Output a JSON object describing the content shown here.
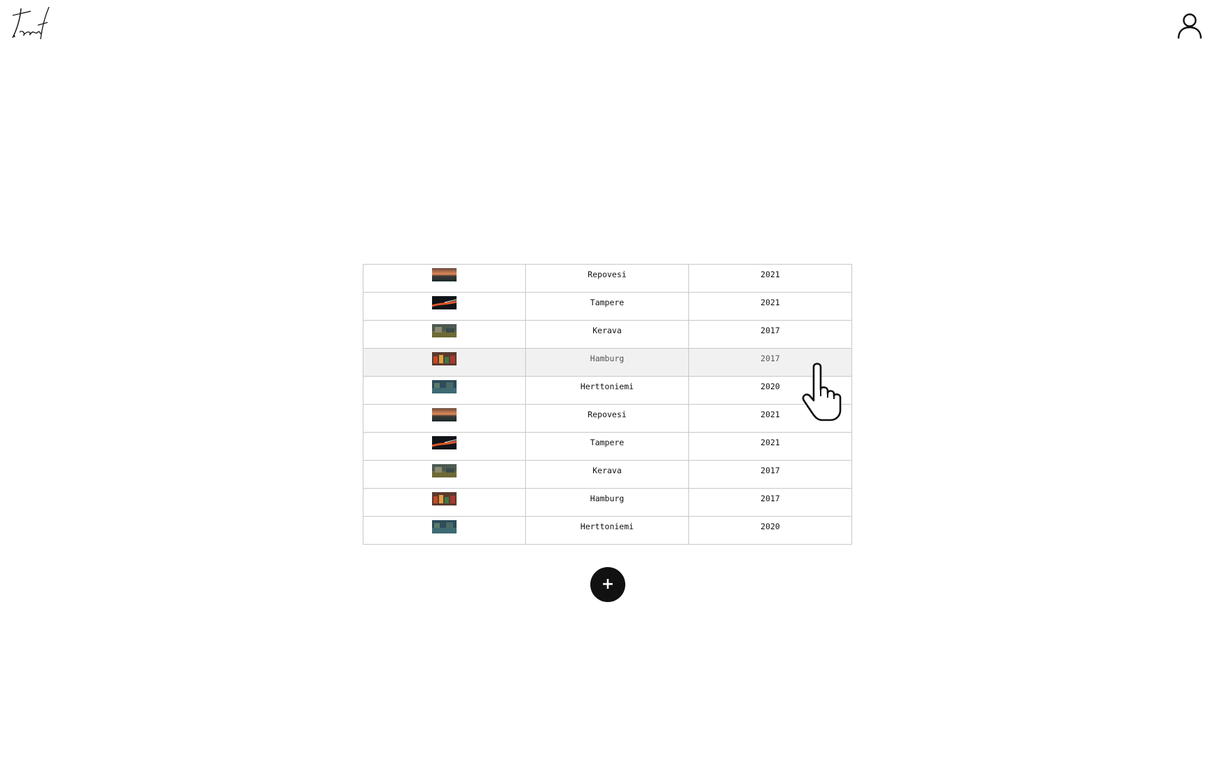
{
  "header": {
    "logo_icon": "signature-logo-icon",
    "user_icon": "user-icon"
  },
  "rows": [
    {
      "thumb": "photo-thumbnail-sunset-lake",
      "place": "Repovesi",
      "year": "2021"
    },
    {
      "thumb": "photo-thumbnail-night-lights",
      "place": "Tampere",
      "year": "2021"
    },
    {
      "thumb": "photo-thumbnail-town-street",
      "place": "Kerava",
      "year": "2017"
    },
    {
      "thumb": "photo-thumbnail-colorful-city",
      "place": "Hamburg",
      "year": "2017"
    },
    {
      "thumb": "photo-thumbnail-blue-harbor",
      "place": "Herttoniemi",
      "year": "2020"
    },
    {
      "thumb": "photo-thumbnail-sunset-lake",
      "place": "Repovesi",
      "year": "2021"
    },
    {
      "thumb": "photo-thumbnail-night-lights",
      "place": "Tampere",
      "year": "2021"
    },
    {
      "thumb": "photo-thumbnail-town-street",
      "place": "Kerava",
      "year": "2017"
    },
    {
      "thumb": "photo-thumbnail-colorful-city",
      "place": "Hamburg",
      "year": "2017"
    },
    {
      "thumb": "photo-thumbnail-blue-harbor",
      "place": "Herttoniemi",
      "year": "2020"
    }
  ],
  "hovered_row": 3,
  "add_button": {
    "label": "+"
  },
  "cursor_icon": "hand-pointer-icon"
}
